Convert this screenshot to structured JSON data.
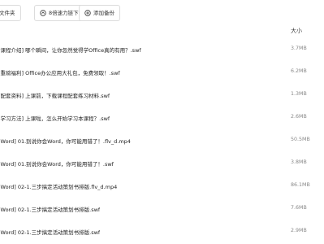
{
  "toolbar": {
    "new_folder_label": "文件夹",
    "speed_download_label": "8倍速力链下载",
    "add_backup_label": "添加备份"
  },
  "columns": {
    "size_header": "大小"
  },
  "files": [
    {
      "name": "[课程介绍] 哪个瞬间，让你忽然觉得学Office真的有用？.swf",
      "size": "3.7MB"
    },
    {
      "name": "[重磅福利] Office办公应用大礼包，免费领取！.swf",
      "size": "6.2MB"
    },
    {
      "name": "[配套资料] 上课前，下载课程配套练习材料.swf",
      "size": "1.3MB"
    },
    {
      "name": "[学习方法] 上课啦，怎么开始学习本课程？.swf",
      "size": "2.6MB"
    },
    {
      "name": "[Word] 01.别说你会Word，你可能用错了！.flv_d.mp4",
      "size": "50.5MB"
    },
    {
      "name": "[Word] 01.别说你会Word，你可能用错了！.swf",
      "size": "3.8MB"
    },
    {
      "name": "[Word] 02-1.三步搞定活动策划书排版.flv_d.mp4",
      "size": "86.1MB"
    },
    {
      "name": "[Word] 02-1.三步搞定活动策划书排版.swf",
      "size": "7.6MB"
    },
    {
      "name": "[Word] 02-1.三步搞定活动策划书排版.swf",
      "size": "2.9MB"
    }
  ]
}
